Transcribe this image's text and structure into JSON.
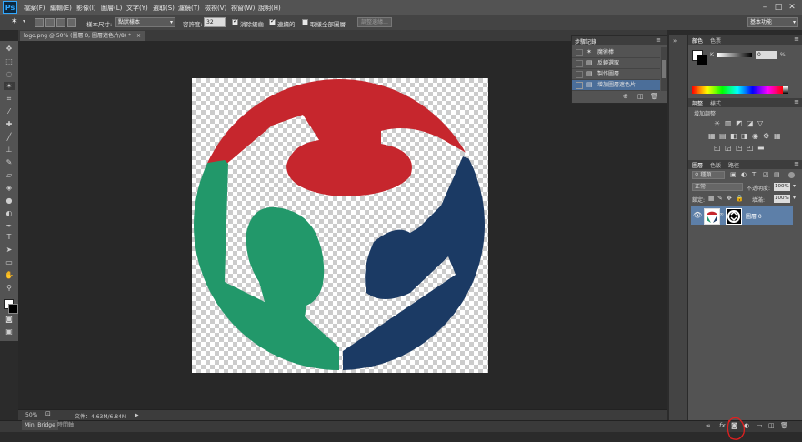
{
  "app": {
    "logo": "Ps"
  },
  "menu": [
    "檔案(F)",
    "編輯(E)",
    "影像(I)",
    "圖層(L)",
    "文字(Y)",
    "選取(S)",
    "濾鏡(T)",
    "檢視(V)",
    "視窗(W)",
    "說明(H)"
  ],
  "window_controls": [
    "–",
    "□",
    "✕"
  ],
  "options": {
    "sample_size_label": "樣本尺寸:",
    "sample_size_value": "點狀樣本",
    "tolerance_label": "容許度:",
    "tolerance_value": "32",
    "antialias_label": "消除鋸齒",
    "contiguous_label": "連續的",
    "all_layers_label": "取樣全部圖層",
    "refine_edge_label": "調整邊緣...",
    "workspace": "基本功能"
  },
  "document": {
    "tab_title": "logo.png @ 50% (圖層 0, 圖層遮色片/8) *",
    "close": "×"
  },
  "history": {
    "title": "步驟記錄",
    "items": [
      "魔術棒",
      "反轉選取",
      "製作圖層",
      "增加圖層遮色片"
    ],
    "selected_index": 3
  },
  "color_panel": {
    "tabs": [
      "顏色",
      "色票"
    ],
    "channel": "K",
    "value": "0",
    "unit": "%"
  },
  "adjustments": {
    "tabs": [
      "調整",
      "樣式"
    ],
    "subtitle": "增加調整"
  },
  "layers": {
    "tabs": [
      "圖層",
      "色版",
      "路徑"
    ],
    "filter_type": "種類",
    "blend_mode": "正常",
    "opacity_label": "不透明度:",
    "opacity_value": "100%",
    "lock_label": "鎖定:",
    "fill_label": "填滿:",
    "fill_value": "100%",
    "layer_name": "圖層 0"
  },
  "status": {
    "zoom": "50%",
    "doc_info": "文件：4.63M/6.84M"
  },
  "bottom_tabs": [
    "Mini Bridge",
    "時間軸"
  ],
  "colors": {
    "red": "#c6262d",
    "green": "#22986a",
    "navy": "#1b3a64",
    "accent": "#4b6e99",
    "annotation": "#e02020"
  }
}
